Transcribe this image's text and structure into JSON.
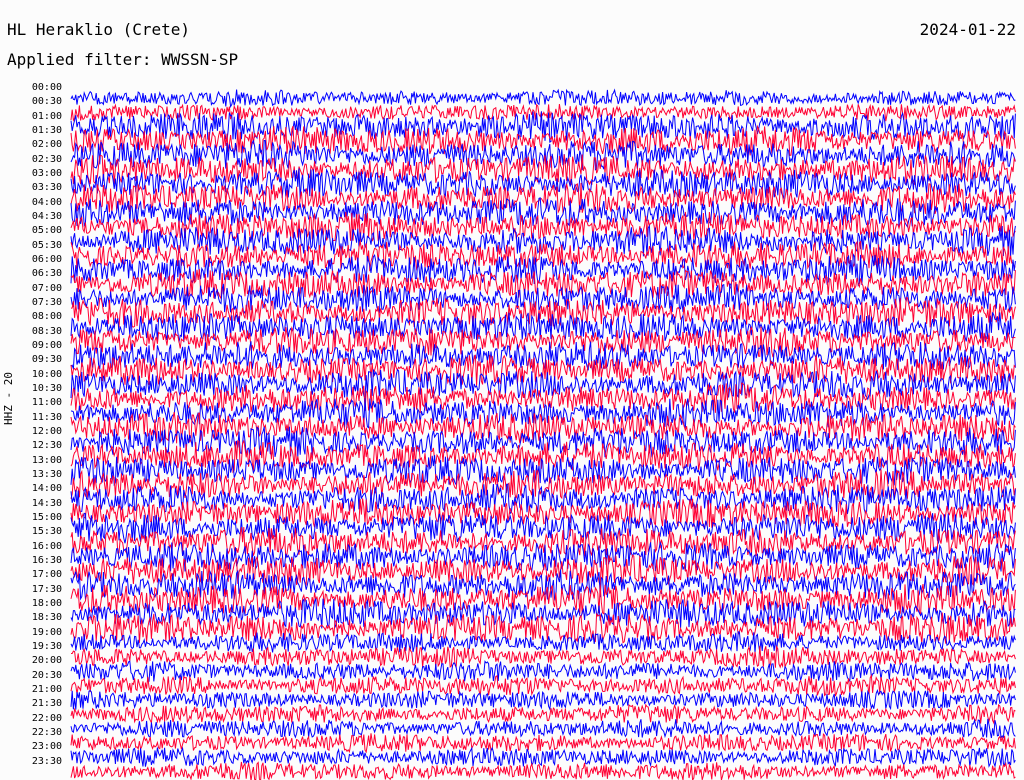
{
  "header": {
    "station": "HL Heraklio (Crete)",
    "date": "2024-01-22",
    "filter": "Applied filter: WWSSN-SP"
  },
  "channel_label": "HHZ - 20",
  "chart_data": {
    "type": "line",
    "title": "HL Heraklio (Crete)",
    "subtitle": "Applied filter: WWSSN-SP",
    "ylabel": "HHZ - 20",
    "trace_start_times": [
      "00:00",
      "00:30",
      "01:00",
      "01:30",
      "02:00",
      "02:30",
      "03:00",
      "03:30",
      "04:00",
      "04:30",
      "05:00",
      "05:30",
      "06:00",
      "06:30",
      "07:00",
      "07:30",
      "08:00",
      "08:30",
      "09:00",
      "09:30",
      "10:00",
      "10:30",
      "11:00",
      "11:30",
      "12:00",
      "12:30",
      "13:00",
      "13:30",
      "14:00",
      "14:30",
      "15:00",
      "15:30",
      "16:00",
      "16:30",
      "17:00",
      "17:30",
      "18:00",
      "18:30",
      "19:00",
      "19:30",
      "20:00",
      "20:30",
      "21:00",
      "21:30",
      "22:00",
      "22:30",
      "23:00",
      "23:30"
    ],
    "trace_colors": [
      "#0000ff",
      "#ff0033"
    ],
    "grid": false
  }
}
